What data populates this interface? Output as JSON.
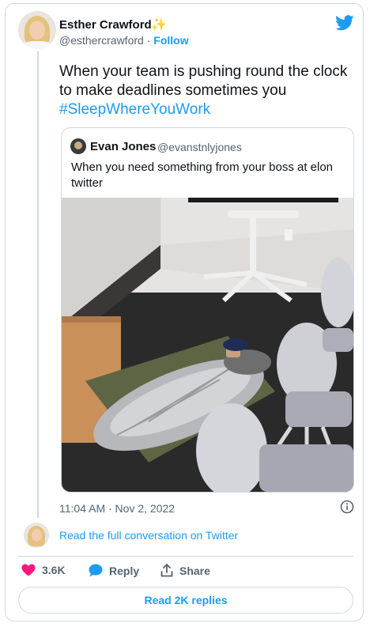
{
  "author": {
    "name": "Esther Crawford",
    "emoji": "✨",
    "handle": "@esthercrawford",
    "separator": "·",
    "follow_label": "Follow"
  },
  "tweet": {
    "text_main": "When your team is pushing round the clock to make deadlines sometimes you",
    "hashtag": "#SleepWhereYouWork"
  },
  "quoted_tweet": {
    "name": "Evan Jones",
    "handle": "@evanstnlyjones",
    "text": "When you need something from your boss at elon twitter"
  },
  "meta": {
    "timestamp": "11:04 AM · Nov 2, 2022"
  },
  "footer": {
    "read_full_label": "Read the full conversation on Twitter",
    "like_count": "3.6K",
    "reply_label": "Reply",
    "share_label": "Share",
    "read_replies_label": "Read 2K replies"
  },
  "colors": {
    "accent": "#1d9bf0",
    "like": "#f91880",
    "secondary_text": "#536471",
    "border": "#cfd9de"
  },
  "icons": [
    "twitter-bird-icon",
    "info-icon",
    "heart-icon",
    "speech-bubble-icon",
    "share-upload-icon"
  ]
}
